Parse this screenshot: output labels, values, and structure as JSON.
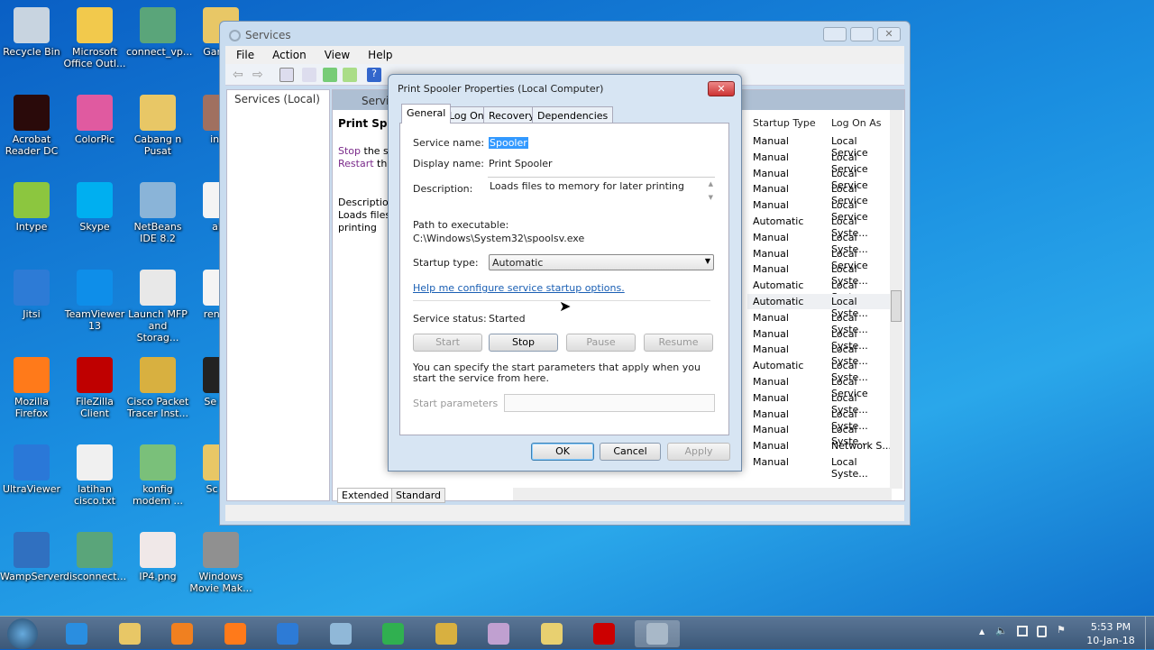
{
  "desktop": {
    "icons": [
      {
        "label": "Recycle Bin",
        "color": "#c8d4e0"
      },
      {
        "label": "Microsoft Office Outl...",
        "color": "#f2c94c"
      },
      {
        "label": "connect_vp...",
        "color": "#5aa57a"
      },
      {
        "label": "Gar Tut",
        "color": "#e8c766"
      },
      {
        "label": "Acrobat Reader DC",
        "color": "#2a0a0a"
      },
      {
        "label": "ColorPic",
        "color": "#e05aa0"
      },
      {
        "label": "Cabang n Pusat",
        "color": "#e8c766"
      },
      {
        "label": "inde",
        "color": "#a07060"
      },
      {
        "label": "Intype",
        "color": "#8cc63f"
      },
      {
        "label": "Skype",
        "color": "#00aff0"
      },
      {
        "label": "NetBeans IDE 8.2",
        "color": "#8ab4d8"
      },
      {
        "label": "aku",
        "color": "#f4f4f4"
      },
      {
        "label": "Jitsi",
        "color": "#2d7bd6"
      },
      {
        "label": "TeamViewer 13",
        "color": "#0e8ee9"
      },
      {
        "label": "Launch MFP and Storag...",
        "color": "#e8e8e8"
      },
      {
        "label": "ren jud",
        "color": "#f4f4f4"
      },
      {
        "label": "Mozilla Firefox",
        "color": "#ff7a1a"
      },
      {
        "label": "FileZilla Client",
        "color": "#bf0000"
      },
      {
        "label": "Cisco Packet Tracer Inst...",
        "color": "#d8b040"
      },
      {
        "label": "Se Rec",
        "color": "#222222"
      },
      {
        "label": "UltraViewer",
        "color": "#2a78d8"
      },
      {
        "label": "latihan cisco.txt",
        "color": "#f0f0f0"
      },
      {
        "label": "konfig modem ...",
        "color": "#7ac07a"
      },
      {
        "label": "Sc Tra",
        "color": "#e8c766"
      },
      {
        "label": "WampServer",
        "color": "#3070c0"
      },
      {
        "label": "disconnect...",
        "color": "#5aa57a"
      },
      {
        "label": "IP4.png",
        "color": "#f0e8e8"
      },
      {
        "label": "Windows Movie Mak...",
        "color": "#909090"
      }
    ]
  },
  "services_window": {
    "title": "Services",
    "menu": [
      "File",
      "Action",
      "View",
      "Help"
    ],
    "tree_item": "Services (Local)",
    "header": "Servic",
    "service_title": "Print Spool",
    "stop_link": "Stop",
    "stop_rest": " the ser",
    "restart_link": "Restart",
    "restart_rest": " the",
    "desc_label": "Description",
    "desc_text": "Loads files t",
    "desc_text2": "printing",
    "columns": [
      "Startup Type",
      "Log On As"
    ],
    "rows": [
      [
        "Manual",
        "Local Service"
      ],
      [
        "Manual",
        "Local Service"
      ],
      [
        "Manual",
        "Local Service"
      ],
      [
        "Manual",
        "Local Service"
      ],
      [
        "Manual",
        "Local Service"
      ],
      [
        "Automatic",
        "Local Syste..."
      ],
      [
        "Manual",
        "Local Syste..."
      ],
      [
        "Manual",
        "Local Service"
      ],
      [
        "Manual",
        "Local Syste..."
      ],
      [
        "Automatic",
        "Local Syste..."
      ],
      [
        "Automatic",
        "Local Syste..."
      ],
      [
        "Manual",
        "Local Syste..."
      ],
      [
        "Manual",
        "Local Syste..."
      ],
      [
        "Manual",
        "Local Syste..."
      ],
      [
        "Automatic",
        "Local Syste..."
      ],
      [
        "Manual",
        "Local Service"
      ],
      [
        "Manual",
        "Local Syste..."
      ],
      [
        "Manual",
        "Local Syste..."
      ],
      [
        "Manual",
        "Local Syste..."
      ],
      [
        "Manual",
        "Network S..."
      ],
      [
        "Manual",
        "Local Syste..."
      ]
    ],
    "view_tabs": [
      "Extended",
      "Standard"
    ]
  },
  "dialog": {
    "title": "Print Spooler Properties (Local Computer)",
    "tabs": [
      "General",
      "Log On",
      "Recovery",
      "Dependencies"
    ],
    "active_tab": "General",
    "service_name_label": "Service name:",
    "service_name": "Spooler",
    "display_name_label": "Display name:",
    "display_name": "Print Spooler",
    "description_label": "Description:",
    "description": "Loads files to memory for later printing",
    "path_label": "Path to executable:",
    "path": "C:\\Windows\\System32\\spoolsv.exe",
    "startup_type_label": "Startup type:",
    "startup_type": "Automatic",
    "help_link": "Help me configure service startup options.",
    "status_label": "Service status:",
    "status": "Started",
    "buttons": {
      "start": "Start",
      "stop": "Stop",
      "pause": "Pause",
      "resume": "Resume",
      "ok": "OK",
      "cancel": "Cancel",
      "apply": "Apply"
    },
    "params_text": "You can specify the start parameters that apply when you start the service from here.",
    "params_label": "Start parameters",
    "params_value": ""
  },
  "taskbar": {
    "time": "5:53 PM",
    "date": "10-Jan-18",
    "apps": [
      {
        "name": "internet-explorer",
        "color": "#2a8ee0"
      },
      {
        "name": "file-explorer",
        "color": "#e8c766"
      },
      {
        "name": "media-player",
        "color": "#f08020"
      },
      {
        "name": "firefox",
        "color": "#ff7a1a"
      },
      {
        "name": "jitsi",
        "color": "#2d7bd6"
      },
      {
        "name": "notepad",
        "color": "#90b8d8"
      },
      {
        "name": "chat",
        "color": "#30b050"
      },
      {
        "name": "network-tool",
        "color": "#d8b040"
      },
      {
        "name": "paint",
        "color": "#c0a0d0"
      },
      {
        "name": "folder",
        "color": "#e8d070"
      },
      {
        "name": "recorder",
        "color": "#cc0000"
      },
      {
        "name": "services",
        "color": "#a8b8c8"
      }
    ]
  }
}
